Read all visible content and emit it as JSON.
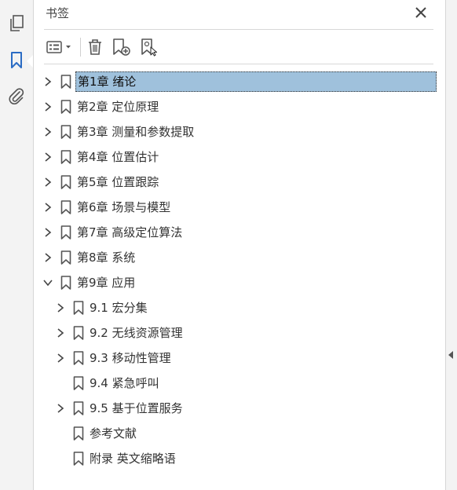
{
  "left_rail": {
    "items": [
      {
        "icon": "pages-icon"
      },
      {
        "icon": "bookmark-icon",
        "active": true
      },
      {
        "icon": "attachment-icon"
      }
    ]
  },
  "panel": {
    "title": "书签",
    "toolbar": [
      "options-dropdown-icon",
      "delete-icon",
      "new-bookmark-icon",
      "new-bookmark-from-structure-icon"
    ]
  },
  "bookmarks": [
    {
      "label": "第1章 绪论",
      "level": 0,
      "expander": "collapsed",
      "selected": true
    },
    {
      "label": "第2章 定位原理",
      "level": 0,
      "expander": "collapsed"
    },
    {
      "label": "第3章 测量和参数提取",
      "level": 0,
      "expander": "collapsed"
    },
    {
      "label": "第4章 位置估计",
      "level": 0,
      "expander": "collapsed"
    },
    {
      "label": "第5章 位置跟踪",
      "level": 0,
      "expander": "collapsed"
    },
    {
      "label": "第6章 场景与模型",
      "level": 0,
      "expander": "collapsed"
    },
    {
      "label": "第7章 高级定位算法",
      "level": 0,
      "expander": "collapsed"
    },
    {
      "label": "第8章 系统",
      "level": 0,
      "expander": "collapsed"
    },
    {
      "label": "第9章 应用",
      "level": 0,
      "expander": "expanded"
    },
    {
      "label": "9.1 宏分集",
      "level": 1,
      "expander": "collapsed"
    },
    {
      "label": "9.2 无线资源管理",
      "level": 1,
      "expander": "collapsed"
    },
    {
      "label": "9.3 移动性管理",
      "level": 1,
      "expander": "collapsed"
    },
    {
      "label": "9.4 紧急呼叫",
      "level": 1,
      "expander": "none"
    },
    {
      "label": "9.5 基于位置服务",
      "level": 1,
      "expander": "collapsed"
    },
    {
      "label": "参考文献",
      "level": 1,
      "expander": "none"
    },
    {
      "label": "附录  英文缩略语",
      "level": 1,
      "expander": "none"
    }
  ],
  "colors": {
    "selection": "#9fc1dc",
    "active_icon": "#2b6cc4",
    "icon": "#555555"
  }
}
